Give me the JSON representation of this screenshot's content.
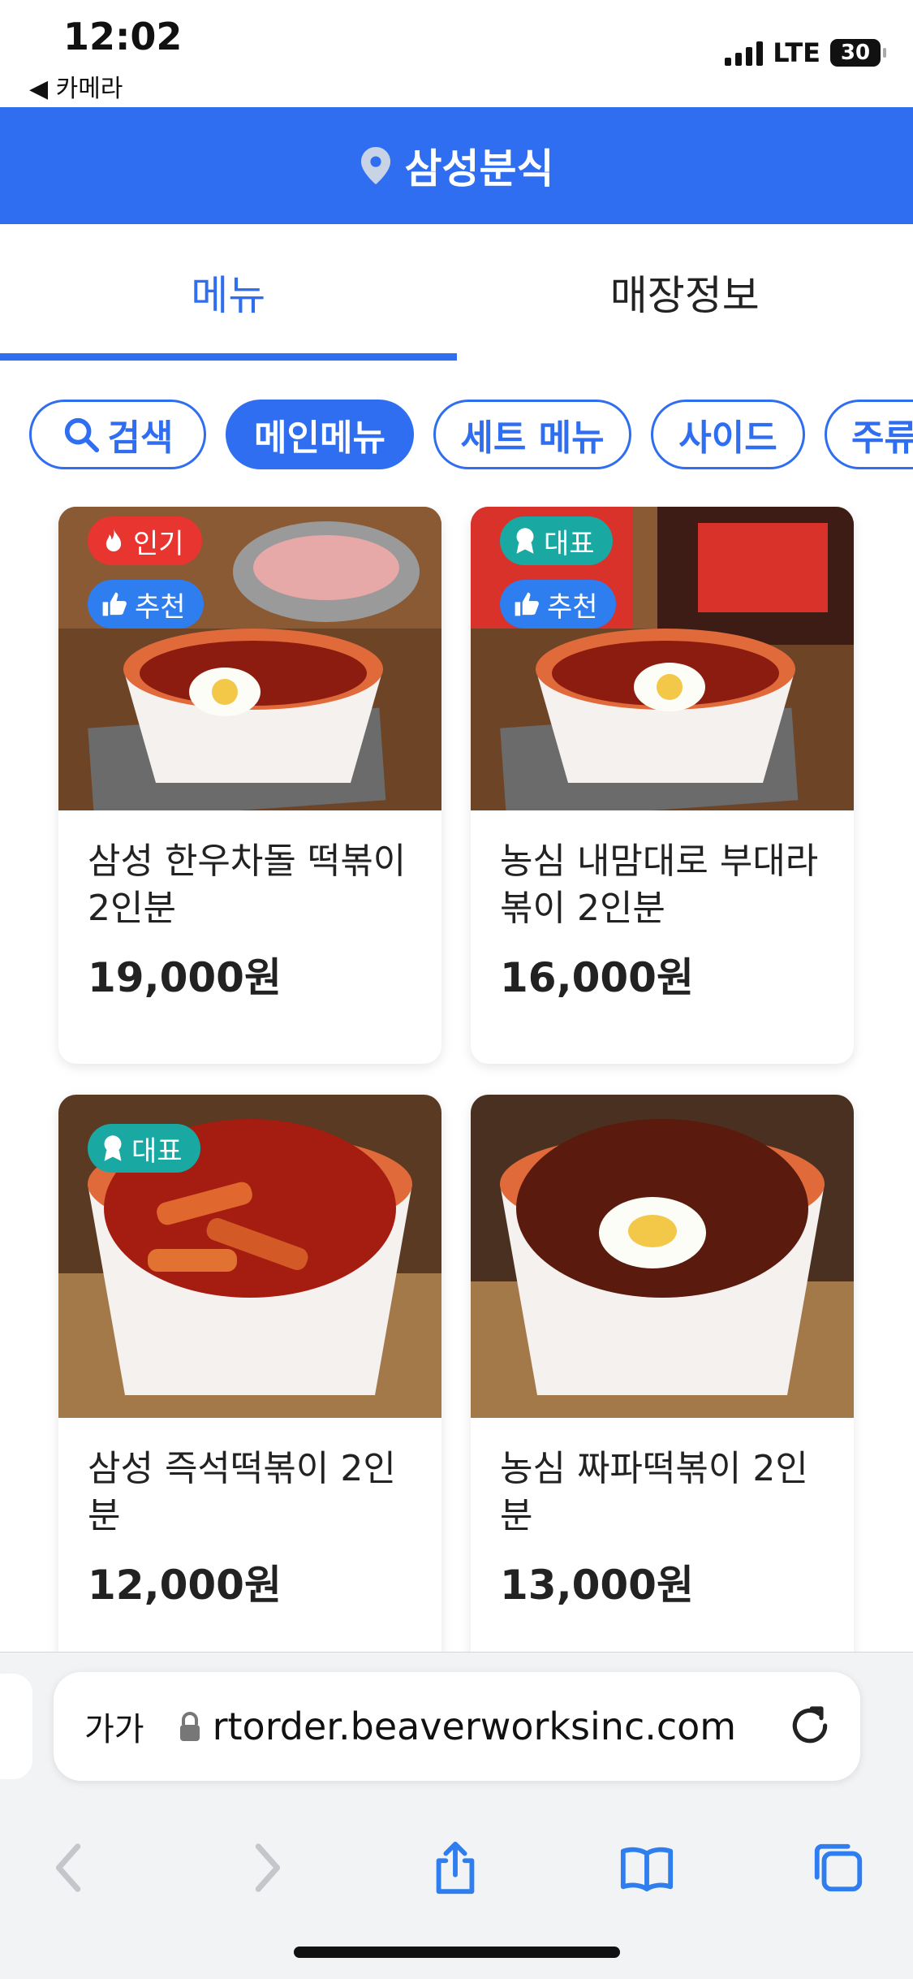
{
  "status": {
    "time": "12:02",
    "back_label": "◀ 카메라",
    "network": "LTE",
    "battery": "30"
  },
  "header": {
    "store_name": "삼성분식"
  },
  "tabs": [
    {
      "label": "메뉴"
    },
    {
      "label": "매장정보"
    }
  ],
  "chips": [
    {
      "label": "검색"
    },
    {
      "label": "메인메뉴"
    },
    {
      "label": "세트 메뉴"
    },
    {
      "label": "사이드"
    },
    {
      "label": "주류"
    }
  ],
  "badges": {
    "hot": "인기",
    "recommend": "추천",
    "representative": "대표"
  },
  "menu": [
    {
      "name": "삼성 한우차돌 떡볶이 2인분",
      "price": "19,000원"
    },
    {
      "name": "농심 내맘대로 부대라볶이 2인분",
      "price": "16,000원"
    },
    {
      "name": "삼성 즉석떡볶이 2인분",
      "price": "12,000원"
    },
    {
      "name": "농심 짜파떡볶이 2인분",
      "price": "13,000원"
    }
  ],
  "browser": {
    "aa": "가가",
    "url": "rtorder.beaverworksinc.com"
  },
  "colors": {
    "primary": "#2f6ef0",
    "hot": "#e8352f",
    "recommend": "#2f7ef0",
    "representative": "#1aa9a2"
  }
}
